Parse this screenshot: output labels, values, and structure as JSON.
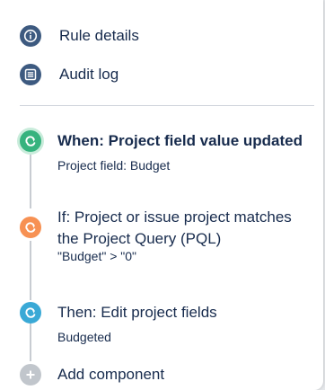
{
  "nav": {
    "rule_details_label": "Rule details",
    "audit_log_label": "Audit log"
  },
  "steps": [
    {
      "title": "When: Project field value updated",
      "subtitle": "Project field: Budget",
      "color": "#36b37e"
    },
    {
      "title": "If: Project or issue project matches the Project Query (PQL)",
      "subtitle": "\"Budget\" > \"0\"",
      "color": "#f79153"
    },
    {
      "title": "Then: Edit project fields",
      "subtitle": "Budgeted",
      "color": "#3aa9d6"
    }
  ],
  "add_component_label": "Add component"
}
